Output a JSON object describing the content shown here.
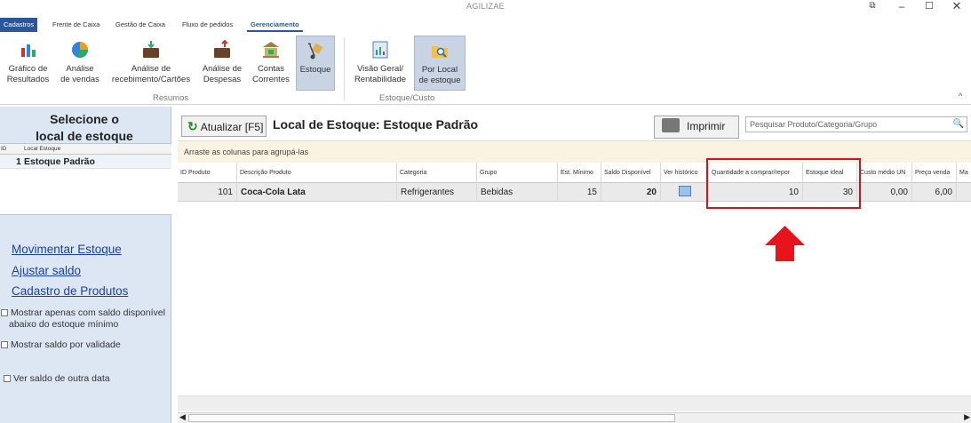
{
  "window": {
    "title": "AGILIZAE",
    "controls": {
      "restore": "⧉",
      "minimize": "–",
      "maximize": "☐",
      "close": "✕"
    }
  },
  "ribbon_tabs": [
    "Cadastros",
    "Frente de Caixa",
    "Gestão de Caixa",
    "Fluxo de pedidos",
    "Gerenciamento"
  ],
  "ribbon": {
    "resumos": {
      "label": "Resumos",
      "buttons": [
        {
          "line1": "Gráfico de",
          "line2": "Resultados"
        },
        {
          "line1": "Análise",
          "line2": "de vendas"
        },
        {
          "line1": "Análise de",
          "line2": "recebimento/Cartões"
        },
        {
          "line1": "Análise de",
          "line2": "Despesas"
        },
        {
          "line1": "Contas",
          "line2": "Correntes"
        },
        {
          "line1": "Estoque",
          "line2": ""
        }
      ]
    },
    "estoque_custo": {
      "label": "Estoque/Custo",
      "buttons": [
        {
          "line1": "Visão Geral/",
          "line2": "Rentabilidade"
        },
        {
          "line1": "Por Local",
          "line2": "de estoque"
        }
      ]
    }
  },
  "left_panel": {
    "title_line1": "Selecione o",
    "title_line2": "local de estoque",
    "grid_headers": {
      "id": "ID",
      "local": "Local Estoque"
    },
    "rows": [
      {
        "id": "1",
        "name": "Estoque Padrão"
      }
    ],
    "links": [
      "Movimentar Estoque",
      "Ajustar saldo",
      "Cadastro de Produtos"
    ],
    "checks": {
      "minimo_line1": "Mostrar apenas com saldo disponível",
      "minimo_line2": "abaixo do estoque mínimo",
      "validade": "Mostrar saldo por validade",
      "outra_data": "Ver saldo de outra data"
    }
  },
  "main": {
    "refresh_label": "Atualizar [F5]",
    "refresh_icon": "↻",
    "title": "Local de Estoque: Estoque Padrão",
    "print_label": "Imprimir",
    "search_placeholder": "Pesquisar Produto/Categoria/Grupo",
    "search_icon": "🔍",
    "group_hint": "Arraste as colunas para agrupá-las",
    "columns": {
      "id": "ID Produto",
      "desc": "Descrição Produto",
      "cat": "Categoria",
      "grupo": "Grupo",
      "min": "Est. Mínimo",
      "saldo": "Saldo Disponível",
      "hist": "Ver histórico",
      "qtd": "Quantidade a comprar/repor",
      "ideal": "Estoque ideal",
      "custo": "Custo médio UN",
      "preco": "Preço venda",
      "ma": "Ma"
    },
    "rows": [
      {
        "id": "101",
        "desc": "Coca-Cola Lata",
        "cat": "Refrigerantes",
        "grupo": "Bebidas",
        "min": "15",
        "saldo": "20",
        "qtd": "10",
        "ideal": "30",
        "custo": "0,00",
        "preco": "6,00"
      }
    ]
  },
  "accent": "#2b579a",
  "highlight_color": "#d4121b"
}
